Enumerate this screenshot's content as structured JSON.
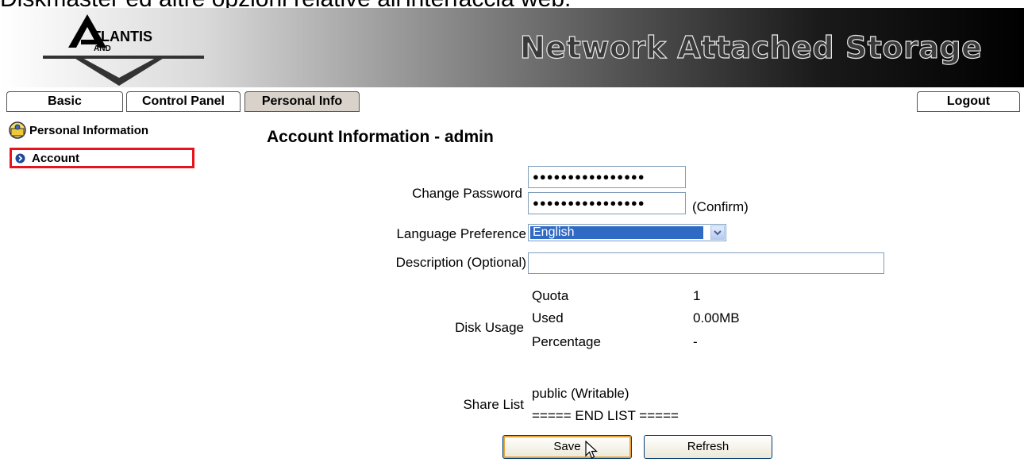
{
  "document": {
    "caption": "Diskmaster ed altre opzioni relative all'interfaccia web."
  },
  "header": {
    "logo_text": "ATLANTIS LAND",
    "title": "Network Attached Storage"
  },
  "tabs": [
    {
      "label": "Basic"
    },
    {
      "label": "Control Panel"
    },
    {
      "label": "Personal Info",
      "active": true
    }
  ],
  "logout_label": "Logout",
  "sidebar": {
    "title": "Personal Information",
    "items": [
      {
        "label": "Account",
        "selected": true
      }
    ]
  },
  "main": {
    "title": "Account Information - admin",
    "change_password": {
      "label": "Change Password",
      "password_mask": "●●●●●●●●●●●●●●●●",
      "confirm_mask": "●●●●●●●●●●●●●●●●",
      "confirm_label": "(Confirm)"
    },
    "language": {
      "label": "Language Preference",
      "selected": "English"
    },
    "description": {
      "label": "Description (Optional)",
      "value": ""
    },
    "disk_usage": {
      "label": "Disk Usage",
      "rows": [
        {
          "key": "Quota",
          "value": "1"
        },
        {
          "key": "Used",
          "value": "0.00MB"
        },
        {
          "key": "Percentage",
          "value": "-"
        }
      ]
    },
    "share_list": {
      "label": "Share List",
      "entries": [
        "public (Writable)",
        "===== END LIST ====="
      ]
    }
  },
  "buttons": {
    "save": "Save",
    "refresh": "Refresh"
  },
  "colors": {
    "highlight_border": "#e8141c",
    "active_tab": "#d9d2ca",
    "select_highlight": "#316ac5",
    "input_border": "#7f9db9"
  },
  "icons": {
    "sidebar_title": "folder-person-icon",
    "account_bullet": "arrow-bullet-icon",
    "dropdown": "chevron-down-icon",
    "pointer": "mouse-cursor-icon"
  }
}
